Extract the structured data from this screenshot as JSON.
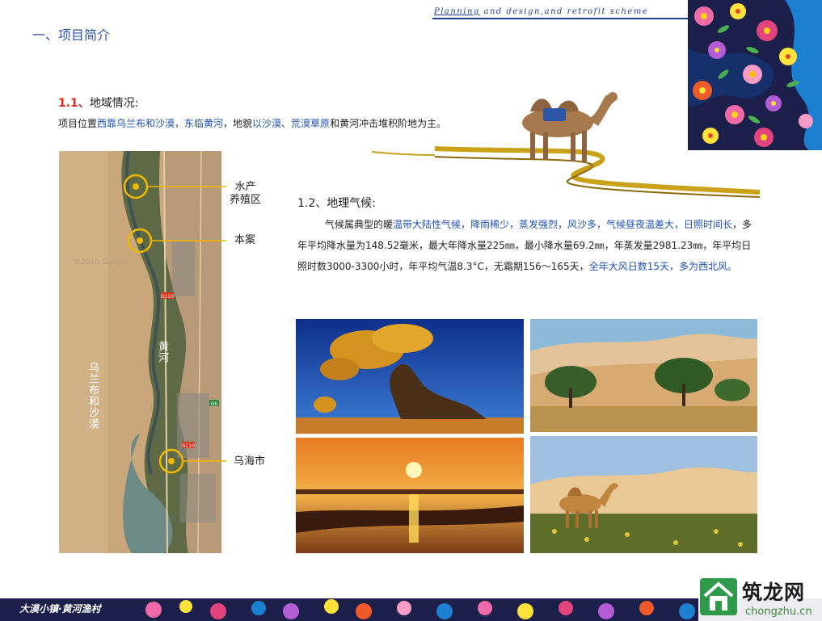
{
  "header": {
    "tagline_lead": "Planning",
    "tagline_rest": " and design,and retrofit scheme"
  },
  "section_title": "一、项目简介",
  "region": {
    "number": "1.1、",
    "title": "地域情况:",
    "desc_parts": [
      {
        "text": "项目位置",
        "highlight": false
      },
      {
        "text": "西靠乌兰布和沙漠，东临黄河",
        "highlight": true
      },
      {
        "text": "，地貌",
        "highlight": false
      },
      {
        "text": "以沙漠、荒漠草原",
        "highlight": true
      },
      {
        "text": "和黄河冲击堆积阶地为主。",
        "highlight": false
      }
    ]
  },
  "map": {
    "labels": {
      "aquaculture_line1": "水产",
      "aquaculture_line2": "养殖区",
      "project": "本案",
      "wuhai": "乌海市",
      "yellow_river": "黄河",
      "desert": "乌兰布和沙漠"
    },
    "road_sign": "G110",
    "road_sign2": "G110",
    "road_sign3": "G6",
    "watermark_text": "©2016 Google"
  },
  "climate": {
    "title": "1.2、地理气候:",
    "parts": [
      {
        "text": "气候属典型的暖",
        "highlight": false
      },
      {
        "text": "温带大陆性气候，降雨稀少，蒸发强烈，风沙多，气候昼夜温差大，日照时间长",
        "highlight": true
      },
      {
        "text": "，多年平均降水量为148.52毫米，最大年降水量225㎜，最小降水量69.2㎜，年蒸发量2981.23㎜，年平均日照时数3000-3300小时，年平均气温8.3°C，无霜期156～165天，",
        "highlight": false
      },
      {
        "text": "全年大风日数15天，多为西北风。",
        "highlight": true
      }
    ]
  },
  "footer": {
    "title": "大漠小镇·黄河渔村"
  },
  "watermark": {
    "title": "筑龙网",
    "url": "chongzhu.cn"
  },
  "colors": {
    "accent_blue": "#1e4fb5",
    "title_blue": "#2b54a8",
    "number_red": "#e0261a",
    "callout_gold": "#f2b800"
  },
  "icons": {
    "camel_decoration": "camel-icon",
    "logo": "house-logo-icon"
  }
}
